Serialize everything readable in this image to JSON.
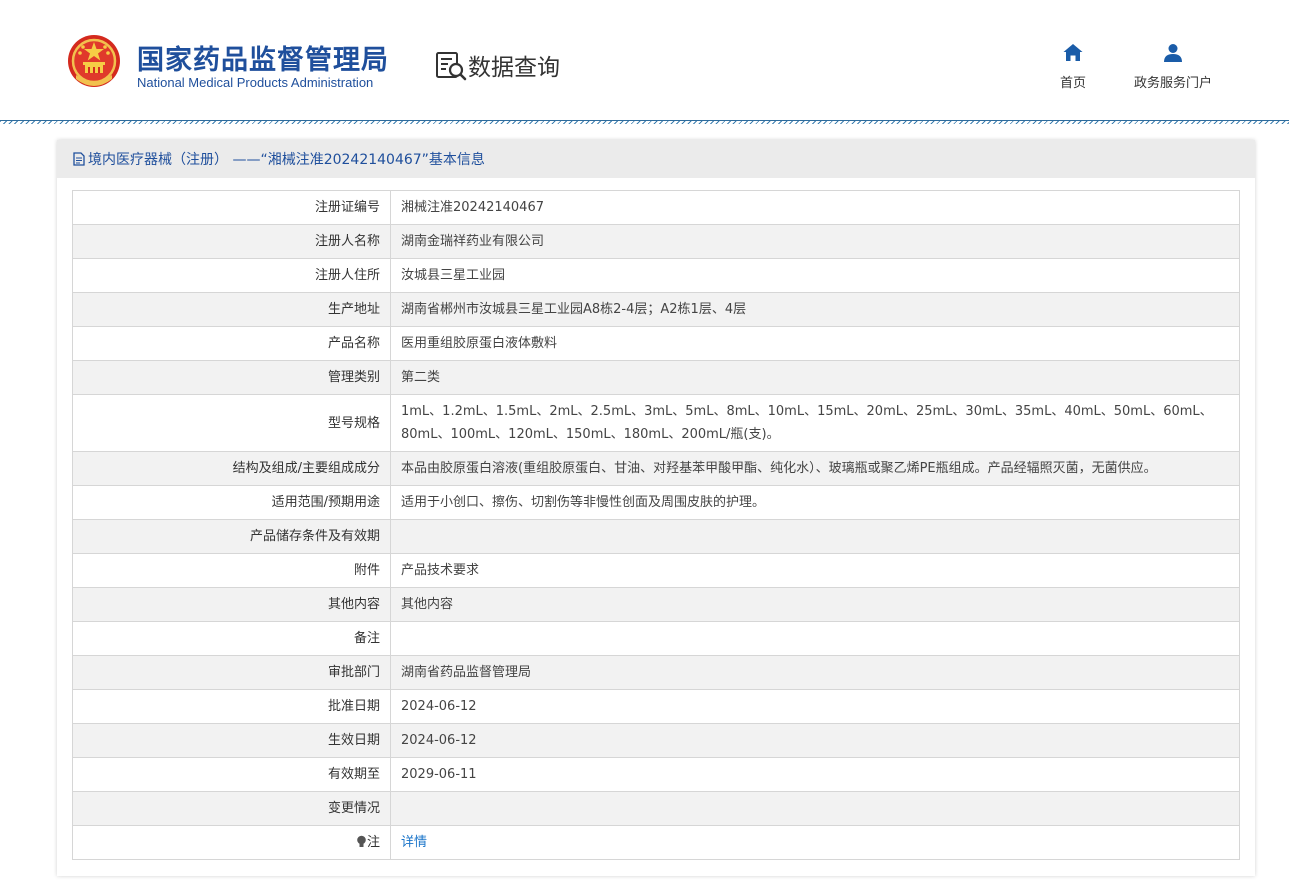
{
  "header": {
    "brand_cn": "国家药品监督管理局",
    "brand_en": "National Medical Products Administration",
    "section_title": "数据查询",
    "nav": [
      {
        "label": "首页",
        "icon": "home-icon"
      },
      {
        "label": "政务服务门户",
        "icon": "user-icon"
      }
    ]
  },
  "panel": {
    "title": "境内医疗器械（注册） ——“湘械注准20242140467”基本信息"
  },
  "rows": [
    {
      "label": "注册证编号",
      "value": "湘械注准20242140467"
    },
    {
      "label": "注册人名称",
      "value": "湖南金瑞祥药业有限公司"
    },
    {
      "label": "注册人住所",
      "value": "汝城县三星工业园"
    },
    {
      "label": "生产地址",
      "value": "湖南省郴州市汝城县三星工业园A8栋2-4层；A2栋1层、4层"
    },
    {
      "label": "产品名称",
      "value": "医用重组胶原蛋白液体敷料"
    },
    {
      "label": "管理类别",
      "value": "第二类"
    },
    {
      "label": "型号规格",
      "value": "1mL、1.2mL、1.5mL、2mL、2.5mL、3mL、5mL、8mL、10mL、15mL、20mL、25mL、30mL、35mL、40mL、50mL、60mL、80mL、100mL、120mL、150mL、180mL、200mL/瓶(支)。"
    },
    {
      "label": "结构及组成/主要组成成分",
      "value": "本品由胶原蛋白溶液(重组胶原蛋白、甘油、对羟基苯甲酸甲酯、纯化水）、玻璃瓶或聚乙烯PE瓶组成。产品经辐照灭菌，无菌供应。"
    },
    {
      "label": "适用范围/预期用途",
      "value": "适用于小创口、擦伤、切割伤等非慢性创面及周围皮肤的护理。"
    },
    {
      "label": "产品储存条件及有效期",
      "value": ""
    },
    {
      "label": "附件",
      "value": "产品技术要求"
    },
    {
      "label": "其他内容",
      "value": "其他内容"
    },
    {
      "label": "备注",
      "value": ""
    },
    {
      "label": "审批部门",
      "value": "湖南省药品监督管理局"
    },
    {
      "label": "批准日期",
      "value": "2024-06-12"
    },
    {
      "label": "生效日期",
      "value": "2024-06-12"
    },
    {
      "label": "有效期至",
      "value": "2029-06-11"
    },
    {
      "label": "变更情况",
      "value": ""
    },
    {
      "label": "注",
      "value": "详情",
      "icon": "lightbulb-icon"
    }
  ]
}
